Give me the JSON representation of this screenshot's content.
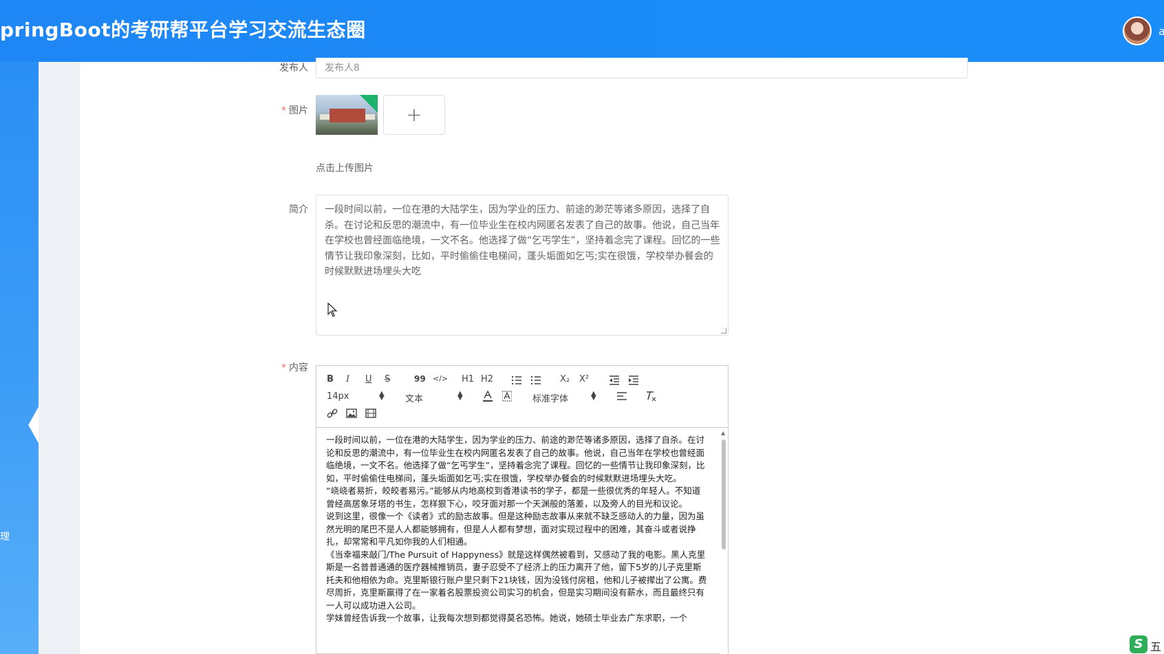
{
  "header": {
    "title": "pringBoot的考研帮平台学习交流生态圈",
    "username": "a"
  },
  "sidebar": {
    "fragments": [
      "",
      "",
      "",
      "",
      "",
      "",
      "",
      "",
      "",
      "理",
      ""
    ]
  },
  "form": {
    "publisher": {
      "label": "发布人",
      "value": "发布人8"
    },
    "image": {
      "label": "图片",
      "required": "*",
      "add_symbol": "+",
      "hint": "点击上传图片"
    },
    "intro": {
      "label": "简介",
      "value": "一段时间以前，一位在港的大陆学生，因为学业的压力、前途的渺茫等诸多原因，选择了自杀。在讨论和反思的潮流中，有一位毕业生在校内网匿名发表了自己的故事。他说，自己当年在学校也曾经面临绝境，一文不名。他选择了做“乞丐学生”，坚持着念完了课程。回忆的一些情节让我印象深刻，比如，平时偷偷住电梯间，蓬头垢面如乞丐;实在很饿，学校举办餐会的时候默默进场埋头大吃"
    },
    "content": {
      "label": "内容",
      "required": "*",
      "toolbar": {
        "bold": "B",
        "italic": "I",
        "underline": "U",
        "strike": "S",
        "quote": "99",
        "code": "</>",
        "h1": "H1",
        "h2": "H2",
        "sub": "X₂",
        "sup": "X²",
        "size": "14px",
        "format": "文本",
        "font": "标准字体"
      },
      "paragraphs": [
        "一段时间以前，一位在港的大陆学生，因为学业的压力、前途的渺茫等诸多原因，选择了自杀。在讨论和反思的潮流中，有一位毕业生在校内网匿名发表了自己的故事。他说，自己当年在学校也曾经面临绝境，一文不名。他选择了做“乞丐学生”，坚持着念完了课程。回忆的一些情节让我印象深刻，比如，平时偷偷住电梯间，蓬头垢面如乞丐;实在很饿，学校举办餐会的时候默默进场埋头大吃。",
        "“峣峣者易折，皎皎者易污。”能够从内地高校到香港读书的学子，都是一些很优秀的年轻人。不知道曾经高居象牙塔的书生，怎样狠下心，咬牙面对那一个天渊般的落差，以及旁人的目光和议论。",
        "说到这里，很像一个《读者》式的励志故事。但是这种励志故事从来就不缺乏感动人的力量，因为虽然光明的尾巴不是人人都能够拥有，但是人人都有梦想，面对实现过程中的困难，其奋斗或者说挣扎，却常常和平凡如你我的人们相通。",
        "《当幸福来敲门/The Pursuit of Happyness》就是这样偶然被看到，又感动了我的电影。黑人克里斯是一名普普通通的医疗器械推销员，妻子忍受不了经济上的压力离开了他，留下5岁的儿子克里斯托夫和他相依为命。克里斯银行账户里只剩下21块钱，因为没钱付房租，他和儿子被撵出了公寓。费尽周折，克里斯赢得了在一家着名股票投资公司实习的机会，但是实习期间没有薪水，而且最终只有一人可以成功进入公司。",
        "学妹曾经告诉我一个故事，让我每次想到都觉得莫名恐怖。她说，她硕士毕业去广东求职，一个"
      ]
    }
  },
  "branding": {
    "corner_logo_letter": "S",
    "corner_logo_text": "五"
  },
  "colors": {
    "header_blue": "#1e86f5",
    "required_red": "#f56c6c",
    "thumb_green": "#19b36b"
  }
}
